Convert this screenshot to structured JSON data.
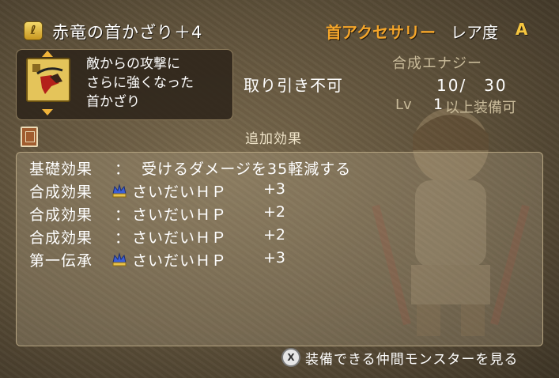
{
  "item": {
    "name": "赤竜の首かざり＋4",
    "category": "首アクセサリー",
    "rarity_label": "レア度",
    "rarity_value": "A",
    "description_lines": [
      "敵からの攻撃に",
      "さらに強くなった",
      "首かざり"
    ],
    "trade_status": "取り引き不可",
    "energy_label": "合成エナジー",
    "energy_value": "10/　30",
    "level_prefix": "Lv",
    "level_value": "1",
    "level_suffix": "以上装備可"
  },
  "effects": {
    "header": "追加効果",
    "rows": [
      {
        "label": "基礎効果",
        "separator": "：",
        "text": "受けるダメージを35軽減する",
        "value": "",
        "has_medal": false
      },
      {
        "label": "合成効果",
        "separator": "",
        "text": "さいだいＨＰ",
        "value": "+3",
        "has_medal": true
      },
      {
        "label": "合成効果",
        "separator": "：",
        "text": "さいだいＨＰ",
        "value": "+2",
        "has_medal": false
      },
      {
        "label": "合成効果",
        "separator": "：",
        "text": "さいだいＨＰ",
        "value": "+2",
        "has_medal": false
      },
      {
        "label": "第一伝承",
        "separator": "",
        "text": "さいだいＨＰ",
        "value": "+3",
        "has_medal": true
      }
    ]
  },
  "footer": {
    "button_glyph": "X",
    "label": "装備できる仲間モンスターを見る"
  },
  "colors": {
    "category": "#f4a52a",
    "rarity": "#f6c640",
    "medal_blue": "#3c5fd6",
    "medal_gold": "#e9c24a"
  }
}
